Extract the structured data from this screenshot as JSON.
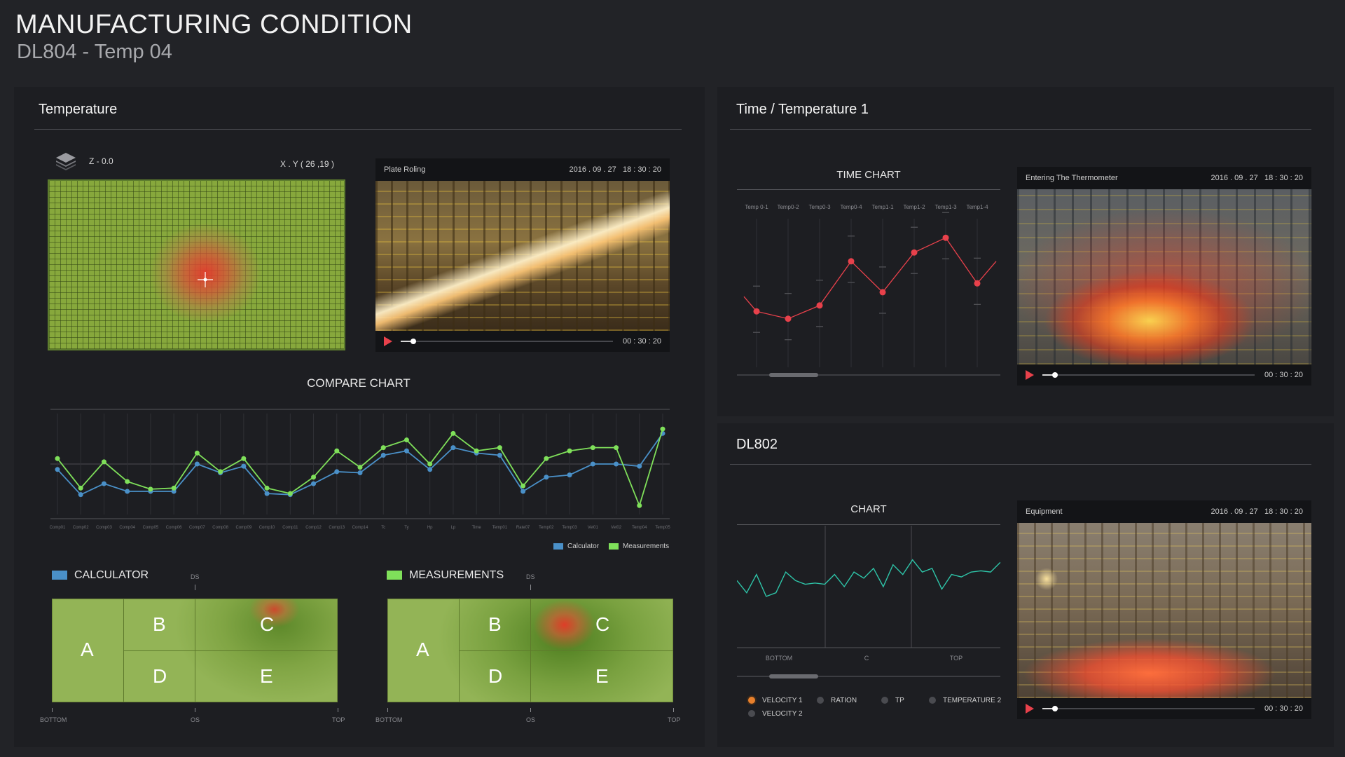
{
  "header": {
    "title": "MANUFACTURING CONDITION",
    "subtitle": "DL804 - Temp 04"
  },
  "temperature_panel": {
    "title": "Temperature",
    "layer_label": "Z - 0.0",
    "coord_label": "X . Y ( 26 ,19 )",
    "video": {
      "title": "Plate Roling",
      "date": "2016 . 09 . 27",
      "time": "18 : 30 : 20",
      "duration": "00 : 30 : 20",
      "progress": 0.06
    }
  },
  "compare_chart": {
    "title": "COMPARE CHART",
    "legend": {
      "calculator": "Calculator",
      "measurements": "Measurements"
    },
    "colors": {
      "calculator": "#4a90c8",
      "measurements": "#7fe05a"
    }
  },
  "zone_maps": {
    "calculator": {
      "title": "CALCULATOR",
      "color": "#4a90c8",
      "zones": [
        "A",
        "B",
        "C",
        "D",
        "E"
      ],
      "top_tick": "DS",
      "axis": [
        "BOTTOM",
        "OS",
        "TOP"
      ]
    },
    "measurements": {
      "title": "MEASUREMENTS",
      "color": "#7fe05a",
      "zones": [
        "A",
        "B",
        "C",
        "D",
        "E"
      ],
      "top_tick": "DS",
      "axis": [
        "BOTTOM",
        "OS",
        "TOP"
      ]
    }
  },
  "time_temp_panel": {
    "title": "Time / Temperature 1",
    "chart_title": "TIME CHART",
    "video": {
      "title": "Entering The Thermometer",
      "date": "2016 . 09 . 27",
      "time": "18 : 30 : 20",
      "duration": "00 : 30 : 20",
      "progress": 0.06
    }
  },
  "dl802_panel": {
    "title": "DL802",
    "chart_title": "CHART",
    "options": [
      "VELOCITY 1",
      "RATION",
      "TP",
      "TEMPERATURE 2",
      "VELOCITY 2"
    ],
    "video": {
      "title": "Equipment",
      "date": "2016 . 09 . 27",
      "time": "18 : 30 : 20",
      "duration": "00 : 30 : 20",
      "progress": 0.06
    }
  },
  "chart_data": [
    {
      "type": "line",
      "name": "COMPARE CHART",
      "title": "COMPARE CHART",
      "categories": [
        "Comp01",
        "Comp02",
        "Comp03",
        "Comp04",
        "Comp05",
        "Comp06",
        "Comp07",
        "Comp08",
        "Comp09",
        "Comp10",
        "Comp11",
        "Comp12",
        "Comp13",
        "Comp14",
        "Tc",
        "Ty",
        "Hp",
        "Lp",
        "Time",
        "Temp01",
        "Rate07",
        "Temp02",
        "Temp03",
        "Vel01",
        "Vel02",
        "Temp04",
        "Temp05"
      ],
      "series": [
        {
          "name": "Calculator",
          "values": [
            45,
            22,
            32,
            25,
            25,
            25,
            50,
            42,
            48,
            23,
            22,
            32,
            43,
            42,
            58,
            62,
            45,
            65,
            60,
            58,
            25,
            38,
            40,
            50,
            50,
            48,
            78
          ]
        },
        {
          "name": "Measurements",
          "values": [
            55,
            28,
            52,
            34,
            27,
            28,
            60,
            43,
            55,
            28,
            23,
            38,
            62,
            47,
            65,
            72,
            50,
            78,
            62,
            65,
            30,
            55,
            62,
            65,
            65,
            12,
            82
          ]
        }
      ],
      "ylim": [
        0,
        100
      ]
    },
    {
      "type": "line",
      "name": "TIME CHART",
      "title": "TIME CHART",
      "categories": [
        "Temp 0-1",
        "Temp0-2",
        "Temp0-3",
        "Temp0-4",
        "Temp1-1",
        "Temp1-2",
        "Temp1-3",
        "Temp1-4"
      ],
      "series": [
        {
          "name": "",
          "values": [
            38,
            33,
            42,
            72,
            51,
            78,
            88,
            57
          ]
        }
      ],
      "ylim": [
        0,
        100
      ]
    },
    {
      "type": "line",
      "name": "CHART",
      "title": "CHART",
      "categories": [
        "BOTTOM",
        "C",
        "TOP"
      ],
      "series": [
        {
          "name": "",
          "values": [
            55,
            45,
            60,
            42,
            45,
            62,
            55,
            52,
            53,
            52,
            60,
            50,
            62,
            57,
            65,
            50,
            68,
            60,
            72,
            62,
            65,
            48,
            60,
            58,
            62,
            63,
            62,
            70
          ]
        }
      ],
      "ylim": [
        0,
        100
      ]
    }
  ]
}
